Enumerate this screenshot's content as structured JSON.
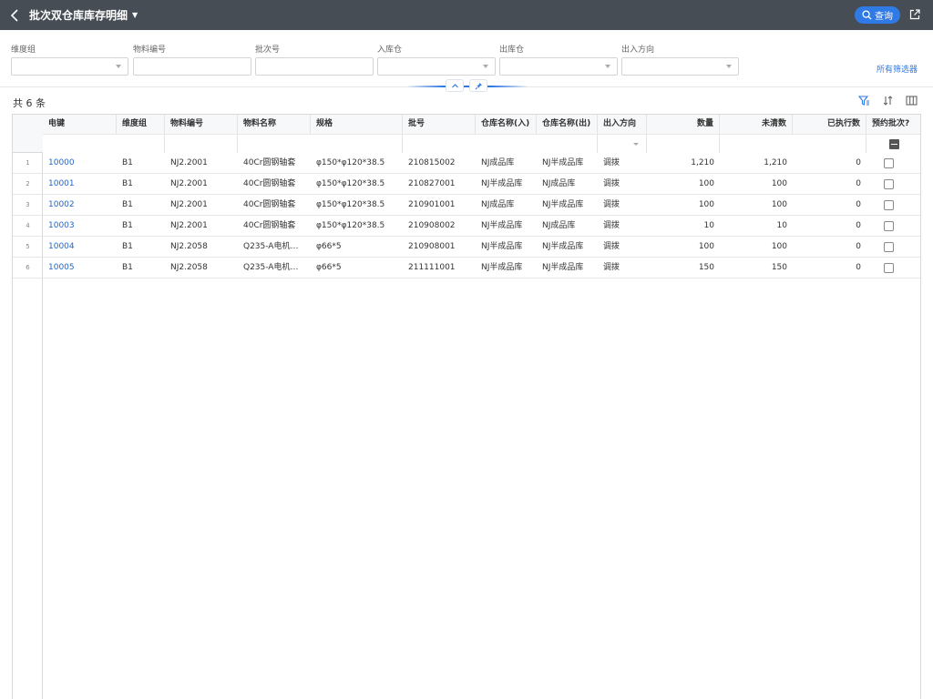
{
  "header": {
    "title": "批次双仓库库存明细",
    "query_label": "查询"
  },
  "filters": {
    "fields": [
      {
        "label": "维度组",
        "value": "",
        "type": "select"
      },
      {
        "label": "物料编号",
        "value": "",
        "type": "text"
      },
      {
        "label": "批次号",
        "value": "",
        "type": "text"
      },
      {
        "label": "入库仓",
        "value": "",
        "type": "select"
      },
      {
        "label": "出库仓",
        "value": "",
        "type": "select"
      },
      {
        "label": "出入方向",
        "value": "",
        "type": "select"
      }
    ],
    "all_filter_label": "所有筛选器"
  },
  "summary": {
    "count_label": "共 6 条"
  },
  "table": {
    "columns": [
      "电键",
      "维度组",
      "物料编号",
      "物料名称",
      "规格",
      "批号",
      "仓库名称(入)",
      "仓库名称(出)",
      "出入方向",
      "数量",
      "未清数",
      "已执行数",
      "预约批次?"
    ],
    "rows": [
      {
        "num": "1",
        "key": "10000",
        "dim": "B1",
        "item": "NJ2.2001",
        "name": "40Cr圆钢轴套",
        "spec": "φ150*φ120*38.5",
        "batch": "210815002",
        "wh_in": "NJ成品库",
        "wh_out": "NJ半成品库",
        "dir": "调拨",
        "qty": "1,210",
        "open": "1,210",
        "done": "0"
      },
      {
        "num": "2",
        "key": "10001",
        "dim": "B1",
        "item": "NJ2.2001",
        "name": "40Cr圆钢轴套",
        "spec": "φ150*φ120*38.5",
        "batch": "210827001",
        "wh_in": "NJ半成品库",
        "wh_out": "NJ成品库",
        "dir": "调拨",
        "qty": "100",
        "open": "100",
        "done": "0"
      },
      {
        "num": "3",
        "key": "10002",
        "dim": "B1",
        "item": "NJ2.2001",
        "name": "40Cr圆钢轴套",
        "spec": "φ150*φ120*38.5",
        "batch": "210901001",
        "wh_in": "NJ成品库",
        "wh_out": "NJ半成品库",
        "dir": "调拨",
        "qty": "100",
        "open": "100",
        "done": "0"
      },
      {
        "num": "4",
        "key": "10003",
        "dim": "B1",
        "item": "NJ2.2001",
        "name": "40Cr圆钢轴套",
        "spec": "φ150*φ120*38.5",
        "batch": "210908002",
        "wh_in": "NJ半成品库",
        "wh_out": "NJ成品库",
        "dir": "调拨",
        "qty": "10",
        "open": "10",
        "done": "0"
      },
      {
        "num": "5",
        "key": "10004",
        "dim": "B1",
        "item": "NJ2.2058",
        "name": "Q235-A电机链...",
        "spec": "φ66*5",
        "batch": "210908001",
        "wh_in": "NJ半成品库",
        "wh_out": "NJ半成品库",
        "dir": "调拨",
        "qty": "100",
        "open": "100",
        "done": "0"
      },
      {
        "num": "6",
        "key": "10005",
        "dim": "B1",
        "item": "NJ2.2058",
        "name": "Q235-A电机链...",
        "spec": "φ66*5",
        "batch": "211111001",
        "wh_in": "NJ半成品库",
        "wh_out": "NJ半成品库",
        "dir": "调拨",
        "qty": "150",
        "open": "150",
        "done": "0"
      }
    ]
  }
}
